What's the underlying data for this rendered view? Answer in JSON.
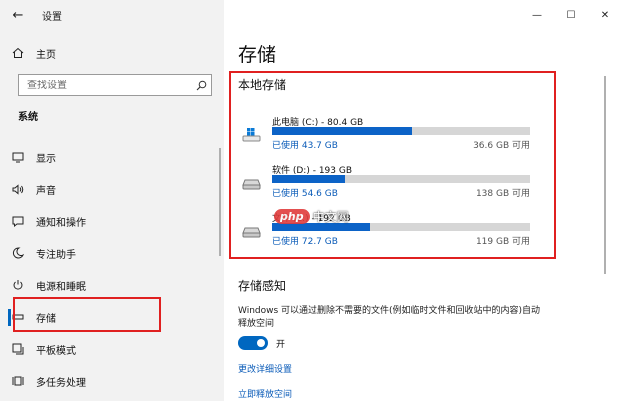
{
  "window": {
    "title": "设置",
    "controls": {
      "minimize": "—",
      "maximize": "☐",
      "close": "✕"
    }
  },
  "sidebar": {
    "back_glyph": "←",
    "home": {
      "icon": "home-icon",
      "label": "主页"
    },
    "search": {
      "placeholder": "查找设置",
      "icon": "search-icon"
    },
    "section": "系统",
    "items": [
      {
        "id": "display",
        "icon": "monitor-icon",
        "label": "显示",
        "active": false
      },
      {
        "id": "sound",
        "icon": "speaker-icon",
        "label": "声音",
        "active": false
      },
      {
        "id": "notifications",
        "icon": "notification-icon",
        "label": "通知和操作",
        "active": false
      },
      {
        "id": "focus",
        "icon": "moon-icon",
        "label": "专注助手",
        "active": false
      },
      {
        "id": "power",
        "icon": "power-icon",
        "label": "电源和睡眠",
        "active": false
      },
      {
        "id": "storage",
        "icon": "storage-icon",
        "label": "存储",
        "active": true
      },
      {
        "id": "tablet",
        "icon": "tablet-icon",
        "label": "平板模式",
        "active": false
      },
      {
        "id": "multitask",
        "icon": "multitask-icon",
        "label": "多任务处理",
        "active": false
      }
    ]
  },
  "main": {
    "title": "存储",
    "local": {
      "title": "本地存储",
      "drives": [
        {
          "name": "此电脑 (C:) - 80.4 GB",
          "used": "已使用 43.7 GB",
          "free": "36.6 GB 可用",
          "used_fraction": 0.543,
          "icon": "windows-drive-icon"
        },
        {
          "name": "软件 (D:) - 193 GB",
          "used": "已使用 54.6 GB",
          "free": "138 GB 可用",
          "used_fraction": 0.283,
          "icon": "drive-icon"
        },
        {
          "name": "文件 (E:) - 192 GB",
          "used": "已使用 72.7 GB",
          "free": "119 GB 可用",
          "used_fraction": 0.379,
          "icon": "drive-icon"
        }
      ]
    },
    "sense": {
      "title": "存储感知",
      "description": "Windows 可以通过删除不需要的文件(例如临时文件和回收站中的内容)自动释放空间",
      "toggle_state": "开",
      "toggle_on": true,
      "link_configure": "更改详细设置",
      "link_free": "立即释放空间"
    }
  },
  "watermark": {
    "logo": "php",
    "text": "中文网"
  },
  "colors": {
    "accent": "#0067c0",
    "bar_fill": "#0c63c7",
    "bar_track": "#d6d6d6",
    "highlight": "#e02020"
  }
}
